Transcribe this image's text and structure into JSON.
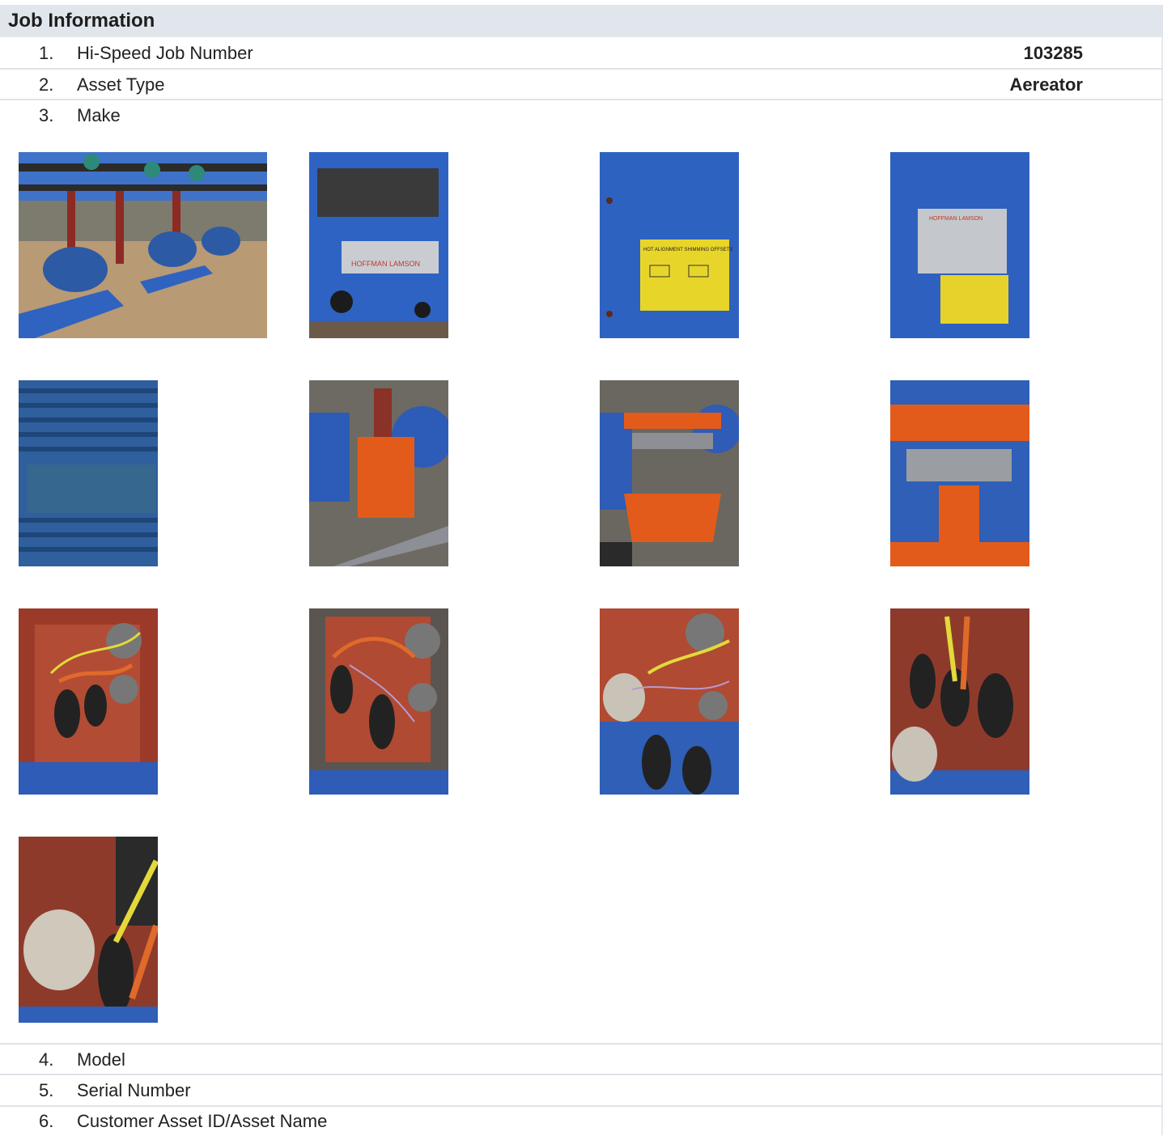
{
  "section": {
    "title": "Job Information"
  },
  "rows": [
    {
      "num": "1.",
      "label": "Hi-Speed Job Number",
      "value": "103285"
    },
    {
      "num": "2.",
      "label": "Asset Type",
      "value": "Aereator"
    },
    {
      "num": "3.",
      "label": "Make",
      "value": ""
    },
    {
      "num": "4.",
      "label": "Model",
      "value": ""
    },
    {
      "num": "5.",
      "label": "Serial Number",
      "value": ""
    },
    {
      "num": "6.",
      "label": "Customer Asset ID/Asset Name",
      "value": ""
    }
  ],
  "photos": [
    {
      "name": "blower-skid-overview-photo"
    },
    {
      "name": "hoffman-lamson-nameplate-photo",
      "caption_text": "HOFFMAN LAMSON"
    },
    {
      "name": "alignment-shimming-label-photo",
      "caption_text": "HOT ALIGNMENT SHIMMING OFFSETS"
    },
    {
      "name": "blower-data-plate-photo",
      "caption_text": "HOFFMAN LAMSON"
    },
    {
      "name": "motor-nameplate-photo"
    },
    {
      "name": "coupling-guard-photo"
    },
    {
      "name": "open-coupling-guard-photo"
    },
    {
      "name": "coupling-closeup-photo"
    },
    {
      "name": "junction-box-wiring-photo-1"
    },
    {
      "name": "junction-box-wiring-photo-2"
    },
    {
      "name": "junction-box-wiring-photo-3"
    },
    {
      "name": "junction-box-wiring-photo-4"
    },
    {
      "name": "junction-box-wiring-photo-5"
    }
  ]
}
